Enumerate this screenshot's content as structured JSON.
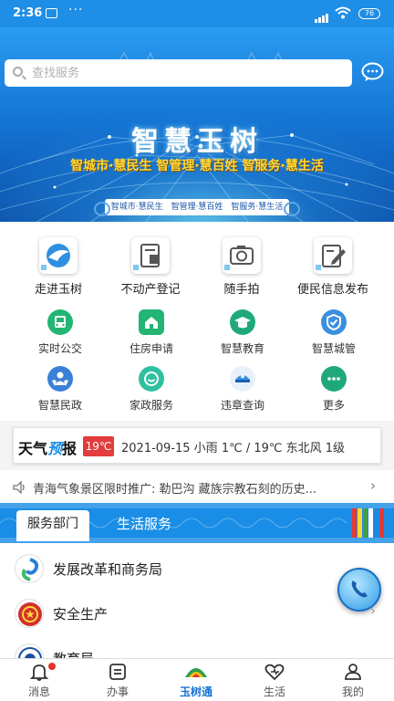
{
  "status_bar": {
    "time": "2:36",
    "battery": "76"
  },
  "search": {
    "placeholder": "查找服务"
  },
  "hero": {
    "title": "智慧玉树",
    "slogan": "智城市·慧民生   智管理·慧百姓   智服务·慧生活",
    "banner": "智城市·慧民生　智管理·慧百姓　智服务·慧生活"
  },
  "main_services": [
    {
      "label": "走进玉树",
      "icon": "bird-logo-icon"
    },
    {
      "label": "不动产登记",
      "icon": "property-document-icon"
    },
    {
      "label": "随手拍",
      "icon": "camera-icon"
    },
    {
      "label": "便民信息发布",
      "icon": "edit-document-icon"
    }
  ],
  "sub_services": [
    {
      "label": "实时公交",
      "icon": "bus-icon",
      "color": "#22b573"
    },
    {
      "label": "住房申请",
      "icon": "house-icon",
      "color": "#22b573"
    },
    {
      "label": "智慧教育",
      "icon": "graduation-cap-icon",
      "color": "#1fa97a"
    },
    {
      "label": "智慧城管",
      "icon": "shield-icon",
      "color": "#3a8fe0"
    },
    {
      "label": "智慧民政",
      "icon": "people-icon",
      "color": "#3a7fd8"
    },
    {
      "label": "家政服务",
      "icon": "service-icon",
      "color": "#2fc0a0"
    },
    {
      "label": "违章查询",
      "icon": "police-cap-icon",
      "color": "#3a8fe0"
    },
    {
      "label": "更多",
      "icon": "more-icon",
      "color": "#1fa97a"
    }
  ],
  "weather": {
    "label_a": "天气",
    "label_b": "预",
    "label_c": "报",
    "temp": "19℃",
    "info": "2021-09-15 小雨 1℃ / 19℃ 东北风 1级"
  },
  "news": {
    "text": "青海气象景区限时推广: 勒巴沟 藏族宗教石刻的历史..."
  },
  "tabs": {
    "active": "服务部门",
    "other": "生活服务"
  },
  "departments": [
    {
      "name": "发展改革和商务局"
    },
    {
      "name": "安全生产"
    },
    {
      "name": "教育局"
    }
  ],
  "bottom_nav": [
    {
      "label": "消息",
      "icon": "bell-icon"
    },
    {
      "label": "办事",
      "icon": "list-icon"
    },
    {
      "label": "玉树通",
      "icon": "yushu-logo-icon"
    },
    {
      "label": "生活",
      "icon": "heart-icon"
    },
    {
      "label": "我的",
      "icon": "person-icon"
    }
  ],
  "colors": {
    "primary": "#1a8ee6",
    "nav_active": "#1a75d2",
    "temp_badge": "#e23c3c",
    "hero_slogan": "#ffd83a"
  }
}
